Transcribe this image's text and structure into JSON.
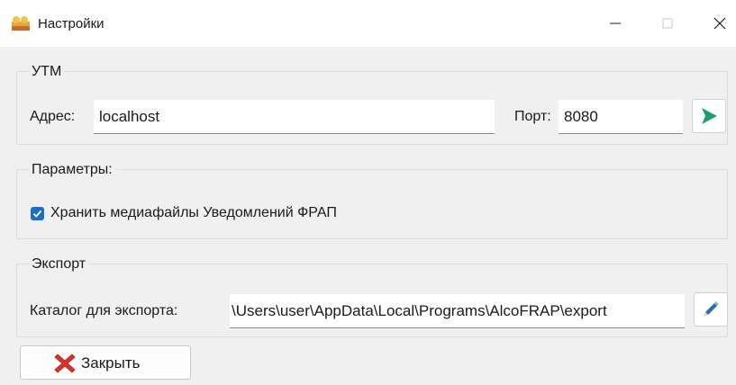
{
  "window": {
    "title": "Настройки"
  },
  "utm": {
    "group_title": "УТМ",
    "address_label": "Адрес:",
    "address_value": "localhost",
    "port_label": "Порт:",
    "port_value": "8080"
  },
  "params": {
    "group_title": "Параметры:",
    "store_media_label": "Хранить медиафайлы Уведомлений ФРАП",
    "store_media_checked": true
  },
  "export": {
    "group_title": "Экспорт",
    "dir_label": "Каталог для экспорта:",
    "dir_value": "\\Users\\user\\AppData\\Local\\Programs\\AlcoFRAP\\export"
  },
  "footer": {
    "close_label": "Закрыть"
  },
  "icons": {
    "app": "app-icon",
    "connect": "play-arrow-icon",
    "edit": "pencil-icon",
    "close": "red-x-icon"
  },
  "colors": {
    "accent_checkbox": "#1a6fc9",
    "play_green": "#1a9e6f",
    "close_red": "#e0302a",
    "client_bg": "#f0f0f0"
  }
}
